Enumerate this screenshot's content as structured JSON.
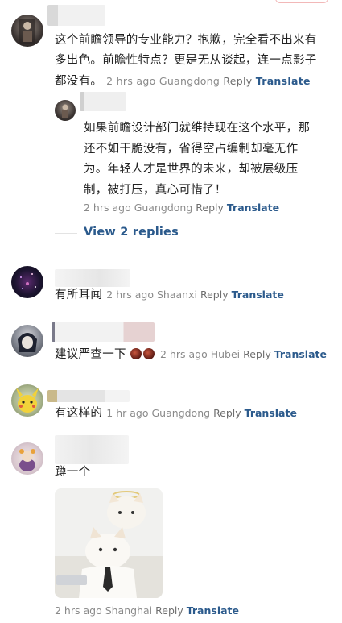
{
  "comments": [
    {
      "text_lines": [
        "这个前瞻领导的专业能力？抱歉，完全看不出来有",
        "多出色。前瞻性特点？更是无从谈起，连一点影子",
        "都没有。"
      ],
      "time": "2 hrs ago",
      "location": "Guangdong",
      "reply_label": "Reply",
      "translate_label": "Translate"
    },
    {
      "text_lines": [
        "如果前瞻设计部门就维持现在这个水平，那",
        "还不如干脆没有，省得空占编制却毫无作",
        "为。年轻人才是世界的未来，却被层级压",
        "制，被打压，真心可惜了！"
      ],
      "time": "2 hrs ago",
      "location": "Guangdong",
      "reply_label": "Reply",
      "translate_label": "Translate"
    },
    {
      "text": "有所耳闻",
      "time": "2 hrs ago",
      "location": "Shaanxi",
      "reply_label": "Reply",
      "translate_label": "Translate"
    },
    {
      "text": "建议严查一下",
      "time": "2 hrs ago",
      "location": "Hubei",
      "reply_label": "Reply",
      "translate_label": "Translate"
    },
    {
      "text": "有这样的",
      "time": "1 hr ago",
      "location": "Guangdong",
      "reply_label": "Reply",
      "translate_label": "Translate"
    },
    {
      "text": "蹲一个",
      "time": "2 hrs ago",
      "location": "Shanghai",
      "reply_label": "Reply",
      "translate_label": "Translate"
    }
  ],
  "view_replies_label": "View 2 replies",
  "colors": {
    "link": "#2b5a8c",
    "meta": "#8a8a8a",
    "text": "#222222"
  },
  "icons": [
    "fire-emoji-icon",
    "fire-emoji-icon"
  ]
}
